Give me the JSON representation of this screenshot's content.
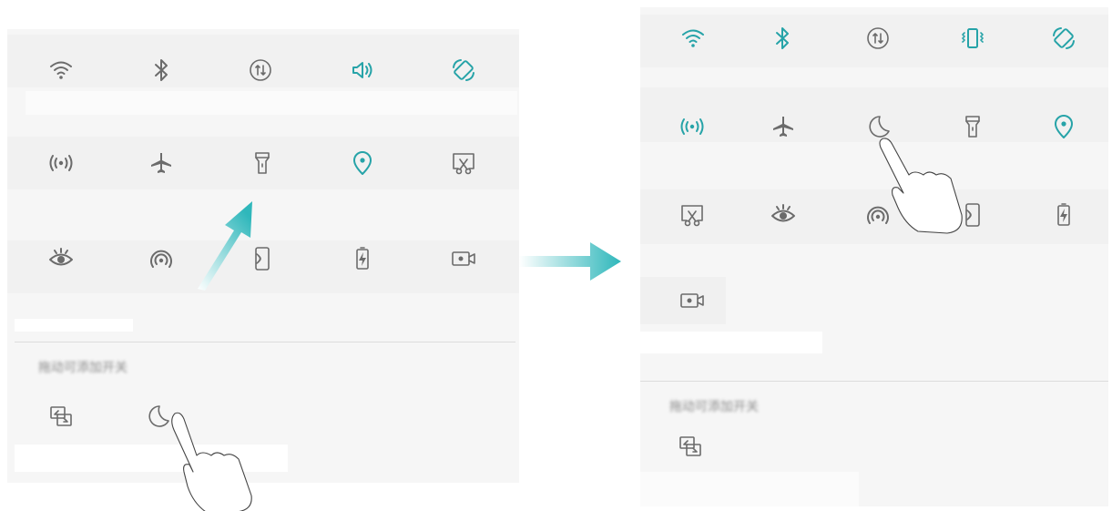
{
  "colors": {
    "active": "#26a3a8",
    "inactive": "#6b6b6b",
    "panel": "#f6f6f6",
    "arrow": "#2fb7bb"
  },
  "before": {
    "active_tiles": [
      {
        "icon": "wifi-icon",
        "active": false
      },
      {
        "icon": "bluetooth-icon",
        "active": false
      },
      {
        "icon": "mobile-data-icon",
        "active": false
      },
      {
        "icon": "sound-icon",
        "active": true
      },
      {
        "icon": "auto-rotate-icon",
        "active": true
      },
      {
        "icon": "hotspot-icon",
        "active": false
      },
      {
        "icon": "airplane-icon",
        "active": false
      },
      {
        "icon": "flashlight-icon",
        "active": false
      },
      {
        "icon": "location-icon",
        "active": true
      },
      {
        "icon": "screenshot-icon",
        "active": false
      },
      {
        "icon": "eye-comfort-icon",
        "active": false
      },
      {
        "icon": "nfc-icon",
        "active": false
      },
      {
        "icon": "huawei-share-icon",
        "active": false
      },
      {
        "icon": "power-saving-icon",
        "active": false
      },
      {
        "icon": "screen-recorder-icon",
        "active": false
      }
    ],
    "drag_section_label": "拖动可添加开关",
    "inactive_tiles": [
      {
        "icon": "projection-icon",
        "active": false
      },
      {
        "icon": "do-not-disturb-icon",
        "active": false
      }
    ]
  },
  "after": {
    "active_tiles": [
      {
        "icon": "wifi-icon",
        "active": true
      },
      {
        "icon": "bluetooth-icon",
        "active": true
      },
      {
        "icon": "mobile-data-icon",
        "active": false
      },
      {
        "icon": "vibrate-icon",
        "active": true
      },
      {
        "icon": "auto-rotate-icon",
        "active": true
      },
      {
        "icon": "hotspot-icon",
        "active": true
      },
      {
        "icon": "airplane-icon",
        "active": false
      },
      {
        "icon": "do-not-disturb-icon",
        "active": false
      },
      {
        "icon": "flashlight-icon",
        "active": false
      },
      {
        "icon": "location-icon",
        "active": true
      },
      {
        "icon": "screenshot-icon",
        "active": false
      },
      {
        "icon": "eye-comfort-icon",
        "active": false
      },
      {
        "icon": "nfc-icon",
        "active": false
      },
      {
        "icon": "huawei-share-icon",
        "active": false
      },
      {
        "icon": "power-saving-icon",
        "active": false
      },
      {
        "icon": "screen-recorder-icon",
        "active": false
      }
    ],
    "drag_section_label": "拖动可添加开关",
    "inactive_tiles": [
      {
        "icon": "projection-icon",
        "active": false
      }
    ]
  }
}
